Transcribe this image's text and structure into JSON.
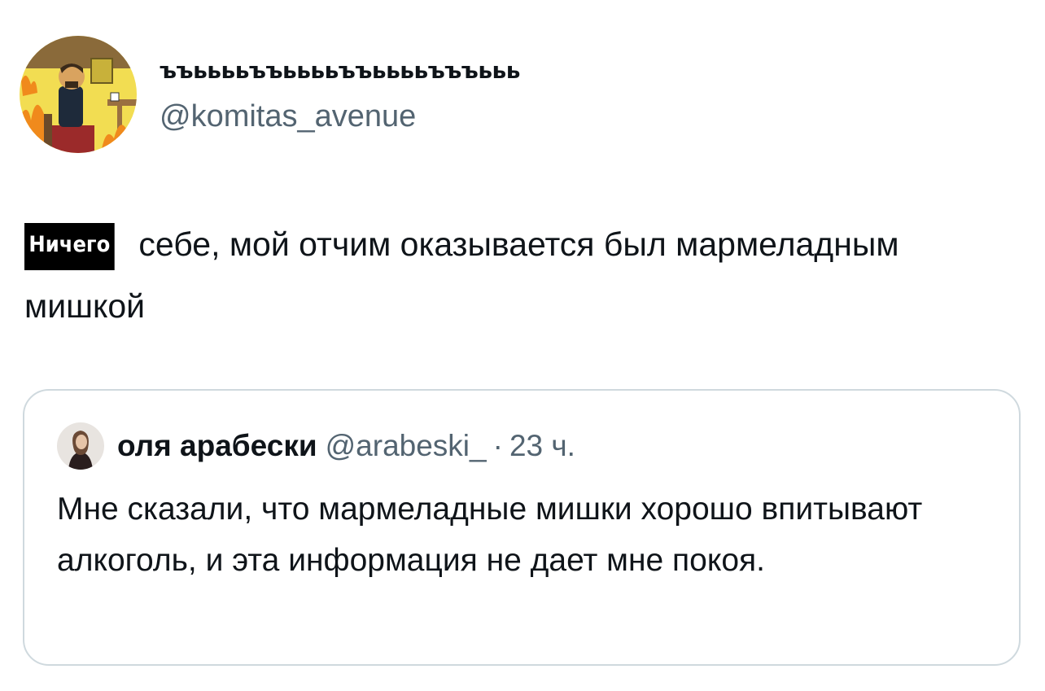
{
  "author": {
    "display_name": "ъъььььъъььььъъььььъъъььь",
    "handle": "@komitas_avenue",
    "avatar_icon": "this-is-fine-dog-avatar-icon"
  },
  "tweet": {
    "highlighted_word": "Ничего",
    "text_rest": " себе, мой отчим оказывается был мармеладным мишкой"
  },
  "quoted_tweet": {
    "display_name": "оля арабески",
    "handle": "@arabeski_",
    "separator": "·",
    "time": "23 ч.",
    "avatar_icon": "user-avatar-icon",
    "text": "Мне сказали, что мармеладные мишки хорошо впитывают алкоголь, и эта информация не дает мне покоя."
  },
  "colors": {
    "text": "#0f1419",
    "secondary": "#536471",
    "border": "#cfd9de",
    "avatar_bg": "#f2dd52",
    "fire": "#f08a1c"
  }
}
